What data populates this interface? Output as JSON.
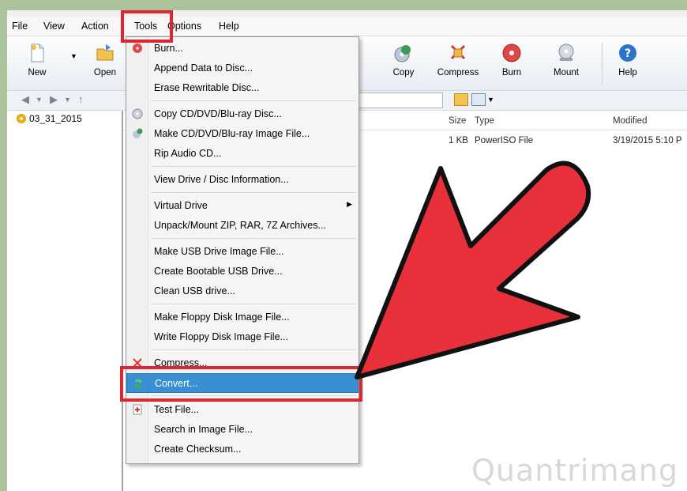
{
  "menubar": {
    "items": [
      "File",
      "View",
      "Action",
      "Tools",
      "Options",
      "Help"
    ]
  },
  "toolbar": {
    "buttons": [
      "New",
      "Open",
      "Copy",
      "Compress",
      "Burn",
      "Mount",
      "Help"
    ]
  },
  "tree": {
    "folder": "03_31_2015"
  },
  "filelist": {
    "columns": [
      "Size",
      "Type",
      "Modified"
    ],
    "rows": [
      {
        "size": "1 KB",
        "type": "PowerISO File",
        "modified": "3/19/2015 5:10 P"
      }
    ]
  },
  "tools_menu": {
    "items": [
      "Burn...",
      "Append Data to Disc...",
      "Erase Rewritable Disc...",
      "Copy CD/DVD/Blu-ray Disc...",
      "Make CD/DVD/Blu-ray Image File...",
      "Rip Audio CD...",
      "View Drive / Disc Information...",
      "Virtual Drive",
      "Unpack/Mount ZIP, RAR, 7Z Archives...",
      "Make USB Drive Image File...",
      "Create Bootable USB Drive...",
      "Clean USB drive...",
      "Make Floppy Disk Image File...",
      "Write Floppy Disk Image File...",
      "Compress...",
      "Convert...",
      "Test File...",
      "Search in Image File...",
      "Create Checksum..."
    ],
    "highlighted": "Convert..."
  },
  "watermark": "Quantrimang",
  "colors": {
    "highlight": "#3a8fd2",
    "annotation_red": "#dc2630",
    "arrow_red": "#e8303a"
  }
}
